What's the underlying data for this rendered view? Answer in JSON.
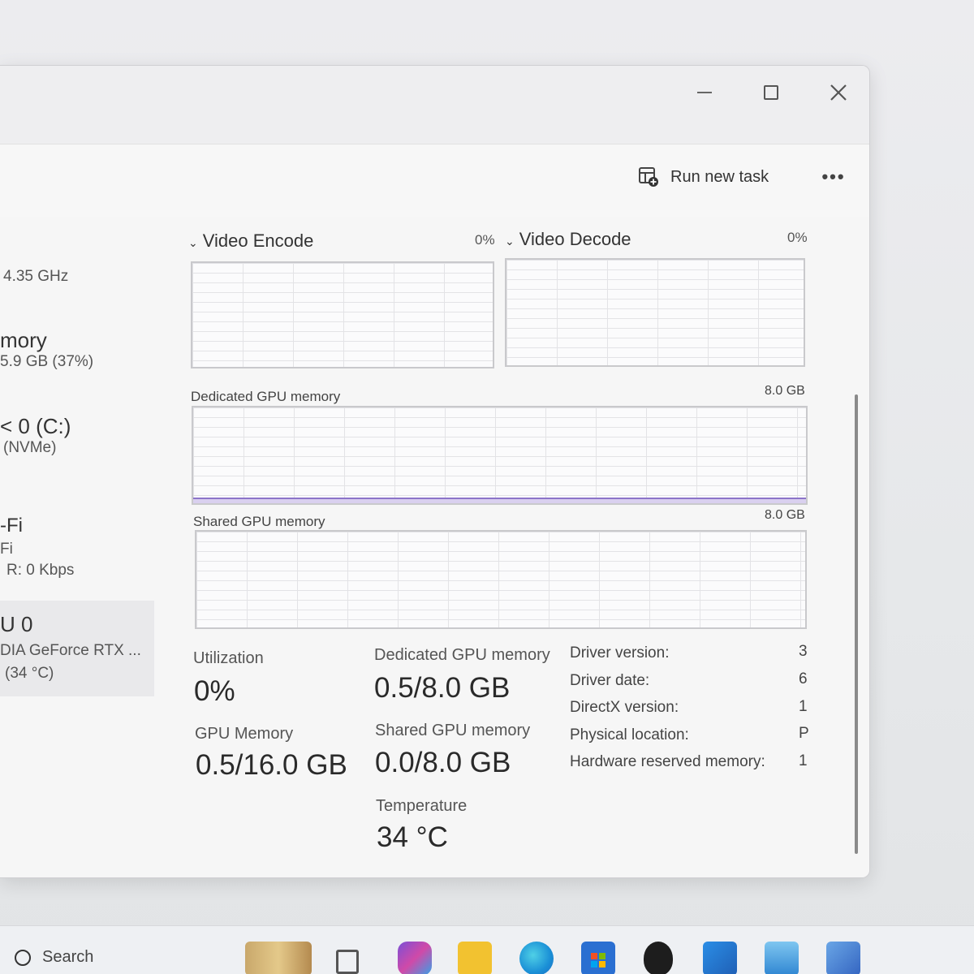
{
  "toolbar": {
    "run_task_label": "Run new task",
    "more_label": "•••"
  },
  "window_controls": {
    "minimize": "minimize",
    "maximize": "maximize",
    "close": "close"
  },
  "sidebar": {
    "items": [
      {
        "title": "",
        "sub": "4.35 GHz"
      },
      {
        "title": "mory",
        "sub": "5.9 GB (37%)"
      },
      {
        "title": "< 0 (C:)",
        "sub": "(NVMe)"
      },
      {
        "title": "-Fi",
        "sub": "Fi",
        "sub2": "R: 0 Kbps"
      },
      {
        "title": "U 0",
        "sub": "DIA GeForce RTX ...",
        "sub2": "(34 °C)"
      }
    ]
  },
  "gpu": {
    "video_encode": {
      "label": "Video Encode",
      "percent": "0%"
    },
    "video_decode": {
      "label": "Video Decode",
      "percent": "0%"
    },
    "dedicated_graph": {
      "label": "Dedicated GPU memory",
      "max": "8.0 GB",
      "level_fraction": 0.06
    },
    "shared_graph": {
      "label": "Shared GPU memory",
      "max": "8.0 GB"
    },
    "stats": {
      "utilization_label": "Utilization",
      "utilization_value": "0%",
      "gpu_memory_label": "GPU Memory",
      "gpu_memory_value": "0.5/16.0 GB",
      "dedicated_label": "Dedicated GPU memory",
      "dedicated_value": "0.5/8.0 GB",
      "shared_label": "Shared GPU memory",
      "shared_value": "0.0/8.0 GB",
      "temperature_label": "Temperature",
      "temperature_value": "34 °C"
    },
    "info": [
      {
        "label": "Driver version:",
        "value": "3"
      },
      {
        "label": "Driver date:",
        "value": "6"
      },
      {
        "label": "DirectX version:",
        "value": "1"
      },
      {
        "label": "Physical location:",
        "value": "P"
      },
      {
        "label": "Hardware reserved memory:",
        "value": "1"
      }
    ]
  },
  "taskbar": {
    "search_label": "Search",
    "icons": [
      "widgets-icon",
      "task-view-icon",
      "m365-icon",
      "file-explorer-icon",
      "edge-icon",
      "store-icon",
      "alienware-icon",
      "outlook-icon",
      "photos-icon",
      "remote-desktop-icon"
    ],
    "colors": {
      "edge": "#1a8fd6",
      "store": "#2a6fd1",
      "explorer": "#f2c230",
      "outlook": "#1f6fc9",
      "photos": "#3b9ad9"
    }
  }
}
